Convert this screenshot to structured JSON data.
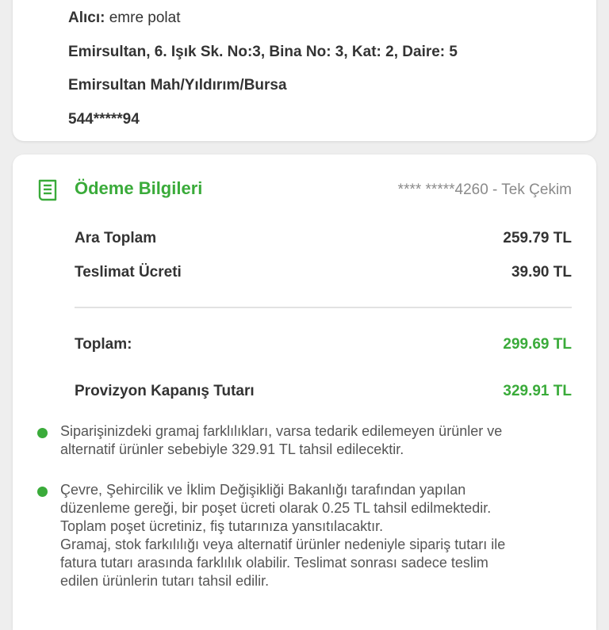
{
  "address": {
    "recipient_label": "Alıcı:",
    "recipient_name": "emre polat",
    "street": "Emirsultan,  6. Işık Sk. No:3, Bina No: 3, Kat: 2, Daire: 5",
    "district": "Emirsultan Mah/Yıldırım/Bursa",
    "phone": "544*****94"
  },
  "payment": {
    "title": "Ödeme Bilgileri",
    "card_info": "**** *****4260 - Tek Çekim",
    "icon": "receipt-icon",
    "rows": [
      {
        "label": "Ara Toplam",
        "value": "259.79 TL"
      },
      {
        "label": "Teslimat Ücreti",
        "value": "39.90 TL"
      }
    ],
    "total": {
      "label": "Toplam:",
      "value": "299.69 TL"
    },
    "provision": {
      "label": "Provizyon Kapanış Tutarı",
      "value": "329.91 TL"
    }
  },
  "notes": [
    {
      "lines": [
        "Siparişinizdeki gramaj farklılıkları, varsa tedarik edilemeyen ürünler ve",
        "alternatif ürünler sebebiyle 329.91 TL tahsil edilecektir."
      ]
    },
    {
      "lines": [
        "Çevre, Şehircilik ve İklim Değişikliği Bakanlığı tarafından yapılan",
        "düzenleme gereği, bir poşet ücreti olarak 0.25 TL tahsil edilmektedir.",
        "Toplam poşet ücretiniz, fiş tutarınıza yansıtılacaktır.",
        "Gramaj, stok farkılılığı veya alternatif ürünler nedeniyle sipariş tutarı ile",
        "fatura tutarı arasında farklılık olabilir. Teslimat sonrası sadece teslim",
        "edilen ürünlerin tutarı tahsil edilir."
      ]
    }
  ],
  "colors": {
    "accent": "#3aab3a",
    "background": "#eeeeee",
    "card": "#ffffff"
  }
}
